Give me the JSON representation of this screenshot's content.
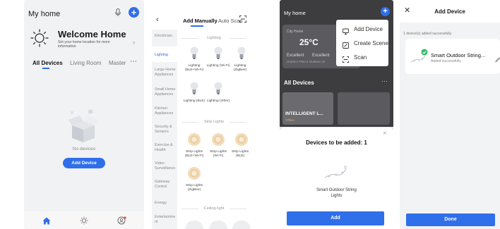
{
  "screen1": {
    "title": "My home",
    "welcome_title": "Welcome Home",
    "welcome_sub": "Set your home location for more information",
    "tabs": [
      "All Devices",
      "Living Room",
      "Master"
    ],
    "more": "⋯",
    "empty_text": "No devices",
    "add_button": "Add Device",
    "nav": [
      "home-icon",
      "scene-icon",
      "profile-icon"
    ]
  },
  "screen2": {
    "tabs": [
      "Add Manually",
      "Auto Scan"
    ],
    "categories": [
      "Electrician",
      "Lighting",
      "Large Home Appliances",
      "Small Home Appliances",
      "Kitchen Appliances",
      "Security & Sensors",
      "Exercise & Health",
      "Video Surveillance",
      "Gateway Control",
      "Energy",
      "Entertainme nt"
    ],
    "sections": [
      "Lighting",
      "Strip Lights",
      "Ceiling light"
    ],
    "lighting_items": [
      "Lighting (BLE+Wi-Fi)",
      "Lighting (Wi-Fi)",
      "Lighting (ZigBee)",
      "Lighting (BLE)",
      "Lighting (other)"
    ],
    "strip_items": [
      "Strip Lights (BLE+Wi-Fi)",
      "Strip Lights (Wi-Fi)",
      "Strip Lights (BLE)",
      "Strip Lights (ZigBee)"
    ]
  },
  "screen3": {
    "title": "My home",
    "temperature": "25°C",
    "weather_label": "City Home",
    "weather_excellent": [
      "Excellent",
      "Excellent"
    ],
    "weather_sub": "Outdoor PM2.5  Outdoor air",
    "menu": [
      "Add Device",
      "Create Scene",
      "Scan"
    ],
    "all_devices": "All Devices",
    "card_label": "INTELLIGENT L...",
    "card_status": "Offline",
    "modal_title": "Devices to be added: 1",
    "modal_device": "Smart Outdoor String Lights",
    "add_button": "Add"
  },
  "screen4": {
    "title": "Add Device",
    "count_text": "1 device(s) added successfully",
    "device_name": "Smart Outdoor String...",
    "device_status": "Added successfully",
    "done_button": "Done"
  },
  "colors": {
    "accent": "#2f6fea",
    "success": "#35b86a"
  }
}
